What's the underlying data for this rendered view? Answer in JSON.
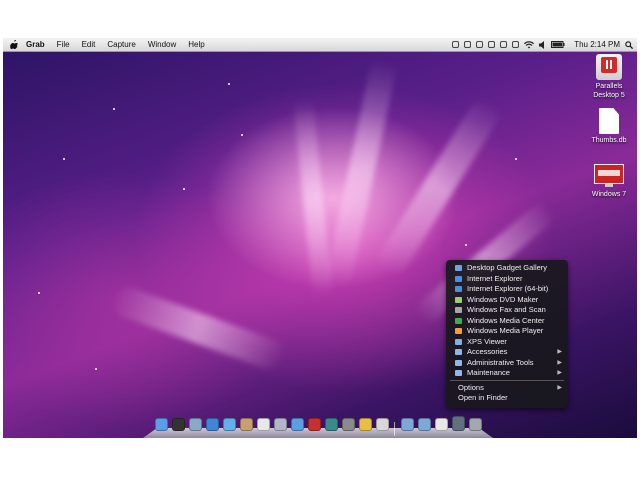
{
  "menubar": {
    "app_name": "Grab",
    "items": [
      "File",
      "Edit",
      "Capture",
      "Window",
      "Help"
    ],
    "clock": "Thu 2:14 PM"
  },
  "desktop_icons": [
    {
      "label": "Parallels\nDesktop 5",
      "icon": "parallels-app-icon"
    },
    {
      "label": "Thumbs.db",
      "icon": "document-icon"
    },
    {
      "label": "Windows 7",
      "icon": "parallels-vm-icon"
    }
  ],
  "context_menu": {
    "items": [
      {
        "label": "Desktop Gadget Gallery",
        "icon": "app-icon",
        "color": "#6fa3e8",
        "submenu": false
      },
      {
        "label": "Internet Explorer",
        "icon": "ie-icon",
        "color": "#4d8fe0",
        "submenu": false
      },
      {
        "label": "Internet Explorer (64-bit)",
        "icon": "ie-icon",
        "color": "#4d8fe0",
        "submenu": false
      },
      {
        "label": "Windows DVD Maker",
        "icon": "dvd-icon",
        "color": "#9ad06a",
        "submenu": false
      },
      {
        "label": "Windows Fax and Scan",
        "icon": "fax-icon",
        "color": "#a8a8a8",
        "submenu": false
      },
      {
        "label": "Windows Media Center",
        "icon": "media-center-icon",
        "color": "#3fae4a",
        "submenu": false
      },
      {
        "label": "Windows Media Player",
        "icon": "media-player-icon",
        "color": "#f2a03a",
        "submenu": false
      },
      {
        "label": "XPS Viewer",
        "icon": "xps-icon",
        "color": "#7fb0e6",
        "submenu": false
      },
      {
        "label": "Accessories",
        "icon": "folder-icon",
        "color": "#8fb8e8",
        "submenu": true
      },
      {
        "label": "Administrative Tools",
        "icon": "folder-icon",
        "color": "#8fb8e8",
        "submenu": true
      },
      {
        "label": "Maintenance",
        "icon": "folder-icon",
        "color": "#8fb8e8",
        "submenu": true
      }
    ],
    "footer_items": [
      {
        "label": "Options",
        "submenu": true
      },
      {
        "label": "Open in Finder",
        "submenu": false
      }
    ]
  },
  "dock": {
    "items": [
      {
        "name": "finder-icon",
        "color": "#5b9ee8"
      },
      {
        "name": "dashboard-icon",
        "color": "#333333"
      },
      {
        "name": "mail-icon",
        "color": "#8aa8c8"
      },
      {
        "name": "safari-icon",
        "color": "#3f86d8"
      },
      {
        "name": "ichat-icon",
        "color": "#62b0e8"
      },
      {
        "name": "address-book-icon",
        "color": "#c8a070"
      },
      {
        "name": "ical-icon",
        "color": "#e8e8e8"
      },
      {
        "name": "preview-icon",
        "color": "#b0b8c8"
      },
      {
        "name": "itunes-icon",
        "color": "#5aa0e0"
      },
      {
        "name": "photobooth-icon",
        "color": "#c83030"
      },
      {
        "name": "time-machine-icon",
        "color": "#3a8a8a"
      },
      {
        "name": "system-preferences-icon",
        "color": "#8a8a8a"
      },
      {
        "name": "windows-icon",
        "color": "#e8c040"
      },
      {
        "name": "parallels-icon",
        "color": "#d8d8d8"
      },
      {
        "name": "applications-folder-icon",
        "color": "#7ea8d8"
      },
      {
        "name": "documents-folder-icon",
        "color": "#7ea8d8"
      },
      {
        "name": "document-stack-icon",
        "color": "#e8e8e8"
      },
      {
        "name": "windows-apps-folder-icon",
        "color": "#607080"
      },
      {
        "name": "trash-icon",
        "color": "#a0a8b0"
      }
    ]
  }
}
